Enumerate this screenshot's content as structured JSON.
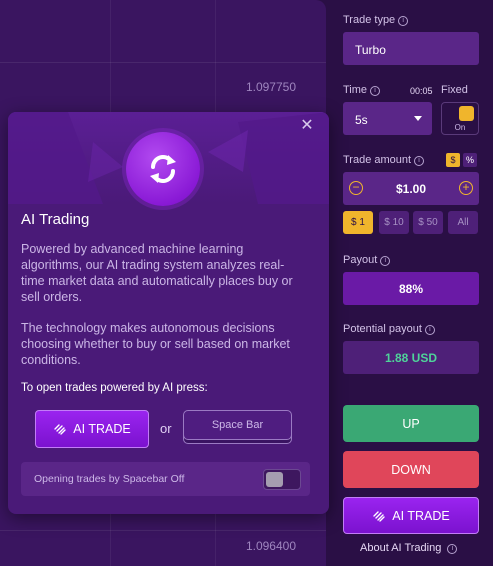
{
  "chart": {
    "price_high": "1.097750",
    "price_low": "1.096400"
  },
  "modal": {
    "title": "AI Trading",
    "paragraph1": "Powered by advanced machine learning algorithms, our AI trading system analyzes real-time market data and automatically places buy or sell orders.",
    "paragraph2": "The technology makes autonomous decisions choosing whether to buy or sell based on market conditions.",
    "open_hint": "To open trades powered by AI press:",
    "ai_trade_label": "AI TRADE",
    "or_label": "or",
    "spacebar_label": "Space Bar",
    "spacebar_setting_label": "Opening trades by Spacebar Off",
    "spacebar_enabled": false,
    "close_icon": "close-icon",
    "logo_icon": "ai-refresh-icon"
  },
  "panel": {
    "trade_type": {
      "label": "Trade type",
      "value": "Turbo"
    },
    "time": {
      "label": "Time",
      "value": "5s",
      "countdown": "00:05"
    },
    "fixed": {
      "label": "Fixed",
      "state_label": "On",
      "enabled": true
    },
    "trade_amount": {
      "label": "Trade amount",
      "currency_options": [
        "$",
        "%"
      ],
      "selected_currency": "$",
      "value": "$1.00",
      "quick_amounts": [
        "$ 1",
        "$ 10",
        "$ 50",
        "All"
      ],
      "selected_quick": "$ 1"
    },
    "payout": {
      "label": "Payout",
      "value": "88%"
    },
    "potential_payout": {
      "label": "Potential payout",
      "value": "1.88 USD"
    },
    "buttons": {
      "up": "UP",
      "down": "DOWN",
      "ai_trade": "AI TRADE"
    },
    "about_ai": "About AI Trading"
  },
  "colors": {
    "background": "#2a0f45",
    "accent_purple": "#8a1ad6",
    "up_green": "#3aa874",
    "down_red": "#e0465a",
    "highlight_yellow": "#f0b52c",
    "payout_green_text": "#4fd39a"
  }
}
